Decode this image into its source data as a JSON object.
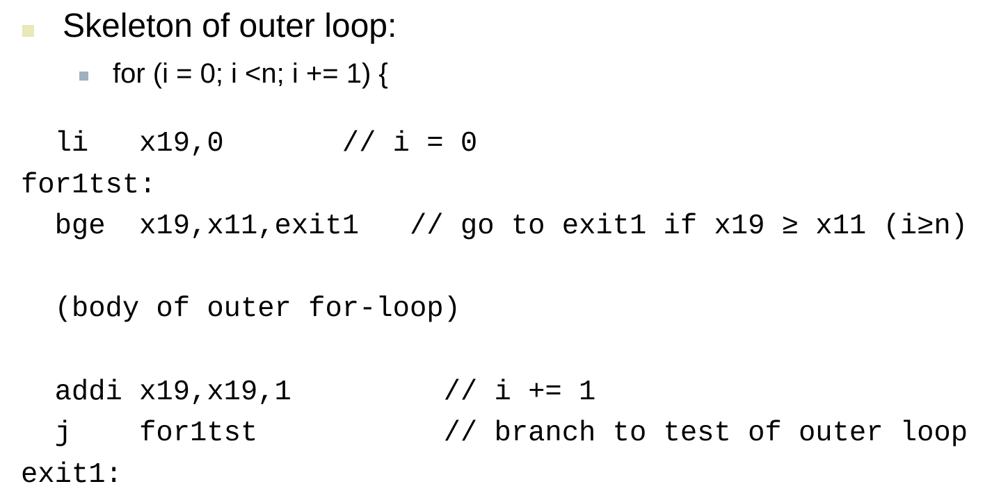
{
  "slide": {
    "heading": "Skeleton of outer loop:",
    "subbullet": "for (i = 0; i <n; i += 1) {",
    "bullet_colors": {
      "level1": "#e8e8b8",
      "level2": "#9fb0c0"
    },
    "code_lines": [
      "  li   x19,0       // i = 0",
      "for1tst:",
      "  bge  x19,x11,exit1   // go to exit1 if x19 ≥ x11 (i≥n)",
      "",
      "  (body of outer for-loop)",
      "",
      "  addi x19,x19,1         // i += 1",
      "  j    for1tst           // branch to test of outer loop",
      "exit1:"
    ]
  }
}
